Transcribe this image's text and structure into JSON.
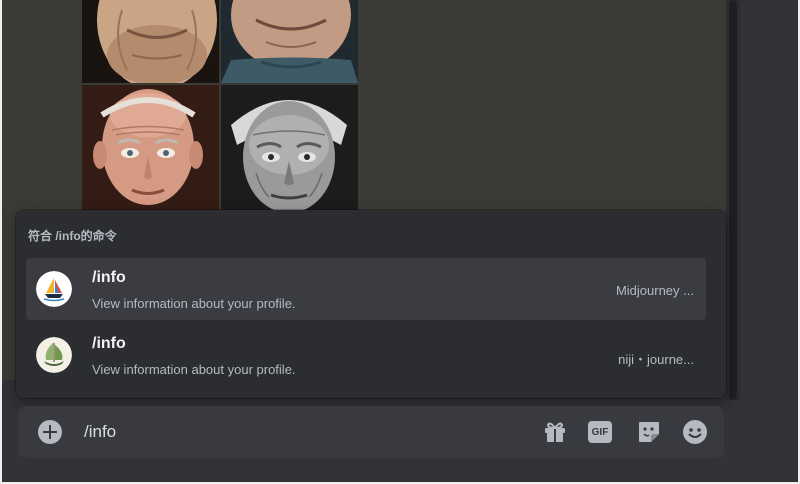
{
  "gallery": {
    "images": [
      {
        "alt": "elderly-man-portrait-1"
      },
      {
        "alt": "elderly-man-portrait-2"
      },
      {
        "alt": "elderly-man-portrait-3"
      },
      {
        "alt": "elderly-man-portrait-4"
      }
    ]
  },
  "autocomplete": {
    "header": "符合 /info的命令",
    "commands": [
      {
        "name": "/info",
        "description": "View information about your profile.",
        "source": "Midjourney ...",
        "icon": "midjourney-sailboat-icon",
        "active": true
      },
      {
        "name": "/info",
        "description": "View information about your profile.",
        "source": "niji・journe...",
        "icon": "niji-sailboat-icon",
        "active": false
      }
    ]
  },
  "composer": {
    "value": "/info",
    "tools": {
      "gift_icon": "gift-icon",
      "gif_label": "GIF",
      "sticker_icon": "sticker-icon",
      "emoji_icon": "emoji-icon"
    }
  },
  "colors": {
    "background": "#313338",
    "popup": "#2b2d31",
    "active_row": "#3a3c42",
    "input_bar": "#383a40",
    "muted_text": "#b5bac1"
  }
}
